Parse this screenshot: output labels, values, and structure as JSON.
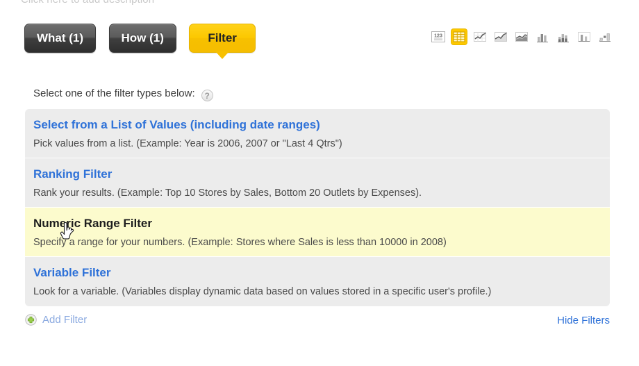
{
  "page": {
    "description_placeholder": "Click here to add description"
  },
  "tabs": [
    {
      "label": "What (1)",
      "name": "tab-what",
      "active": false
    },
    {
      "label": "How (1)",
      "name": "tab-how",
      "active": false
    },
    {
      "label": "Filter",
      "name": "tab-filter",
      "active": true
    }
  ],
  "viz_toolbar": {
    "items": [
      {
        "icon": "numbers-123-icon",
        "label": "123",
        "selected": false
      },
      {
        "icon": "table-grid-icon",
        "label": "Table",
        "selected": true
      },
      {
        "icon": "line-chart-icon",
        "label": "Line Chart",
        "selected": false
      },
      {
        "icon": "area-line-chart-icon",
        "label": "Area Line Chart",
        "selected": false
      },
      {
        "icon": "stacked-area-chart-icon",
        "label": "Stacked Area Chart",
        "selected": false
      },
      {
        "icon": "bar-chart-icon",
        "label": "Bar Chart",
        "selected": false
      },
      {
        "icon": "stacked-bar-chart-icon",
        "label": "Stacked Bar Chart",
        "selected": false
      },
      {
        "icon": "column-chart-icon",
        "label": "Column Chart",
        "selected": false
      },
      {
        "icon": "waterfall-chart-icon",
        "label": "Waterfall Chart",
        "selected": false
      }
    ]
  },
  "filter_panel": {
    "prompt": "Select one of the filter types below:",
    "help_glyph": "?",
    "rows": [
      {
        "title": "Select from a List of Values (including date ranges)",
        "desc": "Pick values from a list. (Example: Year is 2006, 2007 or \"Last 4 Qtrs\")",
        "hovered": false
      },
      {
        "title": "Ranking Filter",
        "desc": "Rank your results. (Example: Top 10 Stores by Sales, Bottom 20 Outlets by Expenses).",
        "hovered": false
      },
      {
        "title": "Numeric Range Filter",
        "desc": "Specify a range for your numbers. (Example: Stores where Sales is less than 10000 in 2008)",
        "hovered": true
      },
      {
        "title": "Variable Filter",
        "desc": "Look for a variable. (Variables display dynamic data based on values stored in a specific user's profile.)",
        "hovered": false
      }
    ]
  },
  "footer": {
    "add_filter_label": "Add Filter",
    "add_filter_icon": "plus-circle-icon",
    "hide_filters_label": "Hide Filters"
  },
  "colors": {
    "accent_yellow": "#fcc800",
    "link_blue": "#2f72d8",
    "row_bg": "#ececec",
    "row_hover_bg": "#fcfbcd",
    "tab_dark": "#4a4a4a",
    "plus_green": "#8cc63f"
  }
}
